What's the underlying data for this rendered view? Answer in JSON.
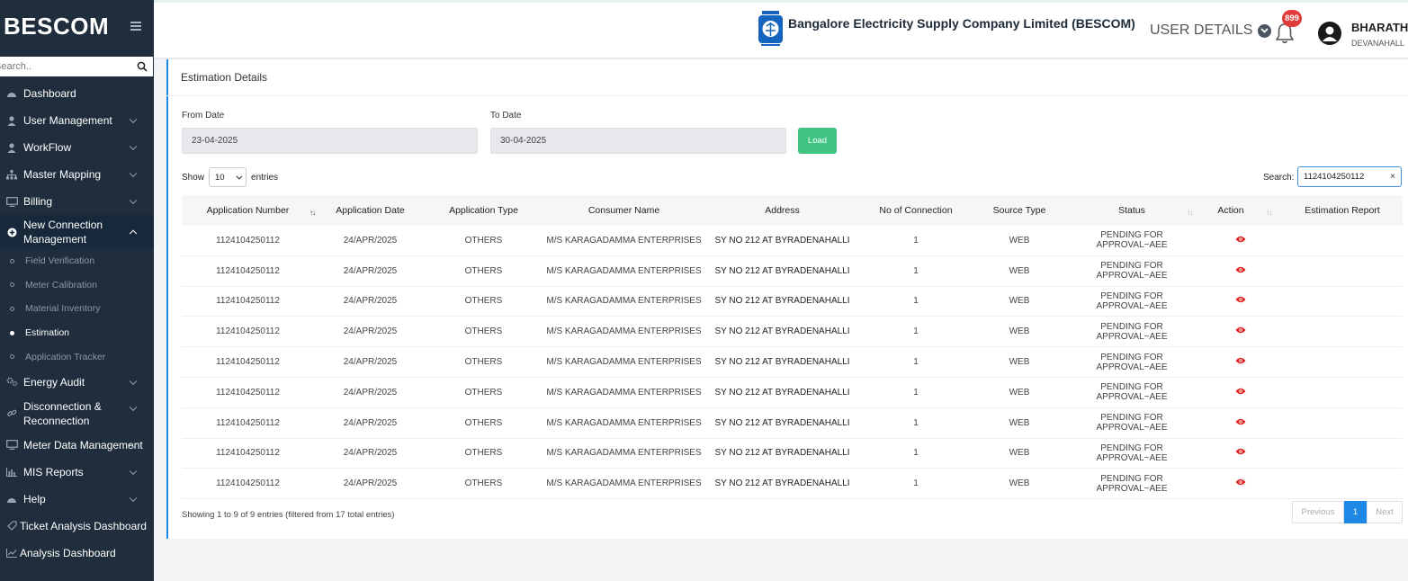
{
  "sidebar": {
    "brand": "BESCOM",
    "search_placeholder": "Search..",
    "items": [
      {
        "label": "Dashboard",
        "icon": "dashboard-icon"
      },
      {
        "label": "User Management",
        "icon": "user-icon"
      },
      {
        "label": "WorkFlow",
        "icon": "user-icon"
      },
      {
        "label": "Master Mapping",
        "icon": "sitemap-icon"
      },
      {
        "label": "Billing",
        "icon": "monitor-icon"
      },
      {
        "label": "New Connection Management",
        "icon": "plus-circle-icon"
      }
    ],
    "sub_items": [
      {
        "label": "Field Verification"
      },
      {
        "label": "Meter Calibration"
      },
      {
        "label": "Material Inventory"
      },
      {
        "label": "Estimation"
      },
      {
        "label": "Application Tracker"
      }
    ],
    "items_after": [
      {
        "label": "Energy Audit",
        "icon": "gears-icon"
      },
      {
        "label": "Disconnection & Reconnection",
        "icon": "link-icon"
      },
      {
        "label": "Meter Data Management",
        "icon": "monitor-icon"
      },
      {
        "label": "MIS Reports",
        "icon": "bar-chart-icon"
      },
      {
        "label": "Help",
        "icon": "dashboard-icon"
      },
      {
        "label": "Ticket Analysis Dashboard",
        "icon": "tag-icon"
      },
      {
        "label": "Analysis Dashboard",
        "icon": "line-chart-icon"
      }
    ]
  },
  "header": {
    "company": "Bangalore Electricity Supply Company Limited (BESCOM)",
    "user_details": "USER DETAILS",
    "notification_count": "899",
    "user_name": "BHARATH",
    "user_location": "DEVANAHALL"
  },
  "card": {
    "title": "Estimation Details",
    "from_label": "From Date",
    "from_value": "23-04-2025",
    "to_label": "To Date",
    "to_value": "30-04-2025",
    "load_label": "Load",
    "show_label": "Show",
    "entries_value": "10",
    "entries_label": "entries",
    "search_label": "Search:",
    "search_value": "1124104250112",
    "search_clear": "×"
  },
  "table": {
    "columns": [
      "Application Number",
      "Application Date",
      "Application Type",
      "Consumer Name",
      "Address",
      "No of Connection",
      "Source Type",
      "Status",
      "Action",
      "Estimation Report"
    ],
    "rows": [
      [
        "1124104250112",
        "24/APR/2025",
        "OTHERS",
        "M/S KARAGADAMMA ENTERPRISES",
        "SY NO 212 AT BYRADENAHALLI",
        "1",
        "WEB",
        "PENDING FOR APPROVAL~AEE"
      ],
      [
        "1124104250112",
        "24/APR/2025",
        "OTHERS",
        "M/S KARAGADAMMA ENTERPRISES",
        "SY NO 212 AT BYRADENAHALLI",
        "1",
        "WEB",
        "PENDING FOR APPROVAL~AEE"
      ],
      [
        "1124104250112",
        "24/APR/2025",
        "OTHERS",
        "M/S KARAGADAMMA ENTERPRISES",
        "SY NO 212 AT BYRADENAHALLI",
        "1",
        "WEB",
        "PENDING FOR APPROVAL~AEE"
      ],
      [
        "1124104250112",
        "24/APR/2025",
        "OTHERS",
        "M/S KARAGADAMMA ENTERPRISES",
        "SY NO 212 AT BYRADENAHALLI",
        "1",
        "WEB",
        "PENDING FOR APPROVAL~AEE"
      ],
      [
        "1124104250112",
        "24/APR/2025",
        "OTHERS",
        "M/S KARAGADAMMA ENTERPRISES",
        "SY NO 212 AT BYRADENAHALLI",
        "1",
        "WEB",
        "PENDING FOR APPROVAL~AEE"
      ],
      [
        "1124104250112",
        "24/APR/2025",
        "OTHERS",
        "M/S KARAGADAMMA ENTERPRISES",
        "SY NO 212 AT BYRADENAHALLI",
        "1",
        "WEB",
        "PENDING FOR APPROVAL~AEE"
      ],
      [
        "1124104250112",
        "24/APR/2025",
        "OTHERS",
        "M/S KARAGADAMMA ENTERPRISES",
        "SY NO 212 AT BYRADENAHALLI",
        "1",
        "WEB",
        "PENDING FOR APPROVAL~AEE"
      ],
      [
        "1124104250112",
        "24/APR/2025",
        "OTHERS",
        "M/S KARAGADAMMA ENTERPRISES",
        "SY NO 212 AT BYRADENAHALLI",
        "1",
        "WEB",
        "PENDING FOR APPROVAL~AEE"
      ],
      [
        "1124104250112",
        "24/APR/2025",
        "OTHERS",
        "M/S KARAGADAMMA ENTERPRISES",
        "SY NO 212 AT BYRADENAHALLI",
        "1",
        "WEB",
        "PENDING FOR APPROVAL~AEE"
      ]
    ],
    "action_icon": "eye-icon",
    "footer_info": "Showing 1 to 9 of 9 entries (filtered from 17 total entries)",
    "pagination": {
      "previous": "Previous",
      "current": "1",
      "next": "Next"
    }
  },
  "colors": {
    "sidebar_bg": "#1f2d3d",
    "accent_blue": "#1e88e5",
    "load_green": "#41c482",
    "badge_red": "#e23b3b",
    "eye_red": "#e02424"
  }
}
